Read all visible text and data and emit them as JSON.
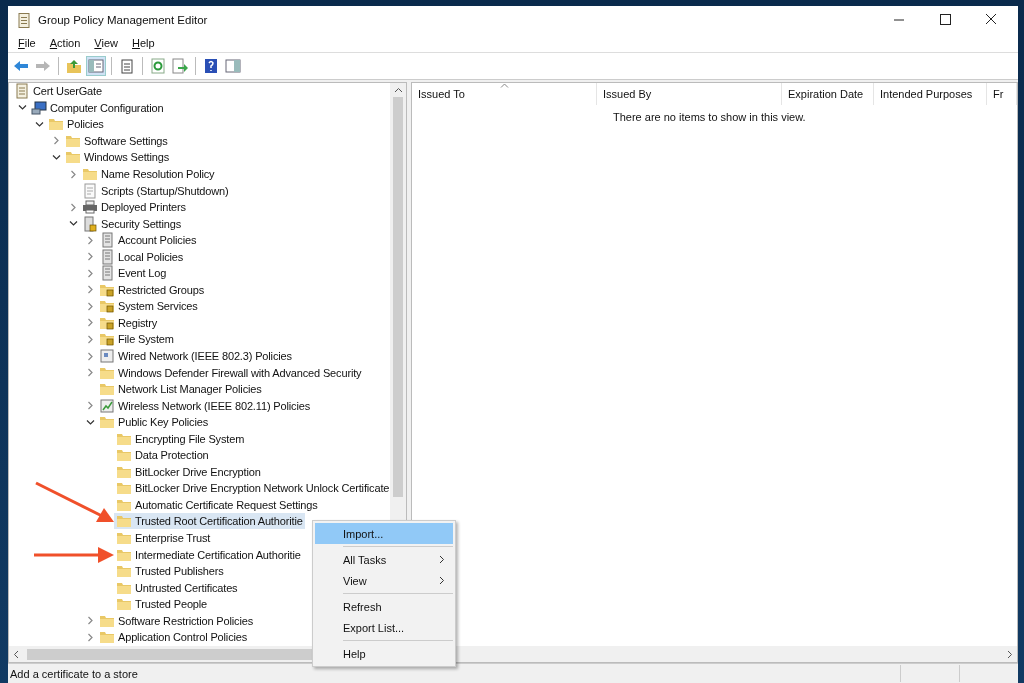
{
  "window": {
    "title": "Group Policy Management Editor"
  },
  "menu": [
    "File",
    "Action",
    "View",
    "Help"
  ],
  "toolbar": [
    [
      {
        "kind": "back",
        "disabled": false,
        "pressed": false
      },
      {
        "kind": "forward",
        "disabled": true,
        "pressed": false
      }
    ],
    [
      {
        "kind": "up",
        "disabled": false,
        "pressed": false
      },
      {
        "kind": "tree",
        "disabled": false,
        "pressed": true
      }
    ],
    [
      {
        "kind": "clipboard",
        "disabled": false,
        "pressed": false
      }
    ],
    [
      {
        "kind": "refresh",
        "disabled": false,
        "pressed": false
      },
      {
        "kind": "export",
        "disabled": false,
        "pressed": false
      }
    ],
    [
      {
        "kind": "help",
        "disabled": false,
        "pressed": false
      },
      {
        "kind": "pane",
        "disabled": false,
        "pressed": false
      }
    ]
  ],
  "tree": [
    {
      "label": "Cert UserGate",
      "kind": "doc",
      "selected": false,
      "children": [
        {
          "label": "Computer Configuration",
          "kind": "computer",
          "selected": false,
          "expanded": true,
          "children": [
            {
              "label": "Policies",
              "kind": "folder",
              "selected": false,
              "expanded": true,
              "children": [
                {
                  "label": "Software Settings",
                  "kind": "folder",
                  "selected": false,
                  "expanded": false
                },
                {
                  "label": "Windows Settings",
                  "kind": "folder",
                  "selected": false,
                  "expanded": true,
                  "children": [
                    {
                      "label": "Name Resolution Policy",
                      "kind": "folder",
                      "selected": false,
                      "expanded": false
                    },
                    {
                      "label": "Scripts (Startup/Shutdown)",
                      "kind": "script",
                      "selected": false
                    },
                    {
                      "label": "Deployed Printers",
                      "kind": "printer",
                      "selected": false,
                      "expanded": false
                    },
                    {
                      "label": "Security Settings",
                      "kind": "security",
                      "selected": false,
                      "expanded": true,
                      "children": [
                        {
                          "label": "Account Policies",
                          "kind": "server",
                          "selected": false,
                          "expanded": false
                        },
                        {
                          "label": "Local Policies",
                          "kind": "server",
                          "selected": false,
                          "expanded": false
                        },
                        {
                          "label": "Event Log",
                          "kind": "server",
                          "selected": false,
                          "expanded": false
                        },
                        {
                          "label": "Restricted Groups",
                          "kind": "lockfolder",
                          "selected": false,
                          "expanded": false
                        },
                        {
                          "label": "System Services",
                          "kind": "lockfolder",
                          "selected": false,
                          "expanded": false
                        },
                        {
                          "label": "Registry",
                          "kind": "lockfolder",
                          "selected": false,
                          "expanded": false
                        },
                        {
                          "label": "File System",
                          "kind": "lockfolder",
                          "selected": false,
                          "expanded": false
                        },
                        {
                          "label": "Wired Network (IEEE 802.3) Policies",
                          "kind": "network",
                          "selected": false,
                          "expanded": false
                        },
                        {
                          "label": "Windows Defender Firewall with Advanced Security",
                          "kind": "folder",
                          "selected": false,
                          "expanded": false
                        },
                        {
                          "label": "Network List Manager Policies",
                          "kind": "folder",
                          "selected": false
                        },
                        {
                          "label": "Wireless Network (IEEE 802.11) Policies",
                          "kind": "wireless",
                          "selected": false,
                          "expanded": false
                        },
                        {
                          "label": "Public Key Policies",
                          "kind": "folder",
                          "selected": false,
                          "expanded": true,
                          "children": [
                            {
                              "label": "Encrypting File System",
                              "kind": "folder",
                              "selected": false
                            },
                            {
                              "label": "Data Protection",
                              "kind": "folder",
                              "selected": false
                            },
                            {
                              "label": "BitLocker Drive Encryption",
                              "kind": "folder",
                              "selected": false
                            },
                            {
                              "label": "BitLocker Drive Encryption Network Unlock Certificate",
                              "kind": "folder",
                              "selected": false
                            },
                            {
                              "label": "Automatic Certificate Request Settings",
                              "kind": "folder",
                              "selected": false
                            },
                            {
                              "label": "Trusted Root Certification Authoritie",
                              "kind": "folder",
                              "selected": true
                            },
                            {
                              "label": "Enterprise Trust",
                              "kind": "folder",
                              "selected": false
                            },
                            {
                              "label": "Intermediate Certification Authoritie",
                              "kind": "folder",
                              "selected": false
                            },
                            {
                              "label": "Trusted Publishers",
                              "kind": "folder",
                              "selected": false
                            },
                            {
                              "label": "Untrusted Certificates",
                              "kind": "folder",
                              "selected": false
                            },
                            {
                              "label": "Trusted People",
                              "kind": "folder",
                              "selected": false
                            }
                          ]
                        },
                        {
                          "label": "Software Restriction Policies",
                          "kind": "folder",
                          "selected": false,
                          "expanded": false
                        },
                        {
                          "label": "Application Control Policies",
                          "kind": "folder",
                          "selected": false,
                          "expanded": false
                        }
                      ]
                    }
                  ]
                }
              ]
            }
          ]
        }
      ]
    }
  ],
  "list": {
    "columns": [
      {
        "label": "Issued To",
        "sorted": true
      },
      {
        "label": "Issued By",
        "sorted": false
      },
      {
        "label": "Expiration Date",
        "sorted": false
      },
      {
        "label": "Intended Purposes",
        "sorted": false
      },
      {
        "label": "Fr",
        "sorted": false
      }
    ],
    "empty_message": "There are no items to show in this view."
  },
  "context_menu": [
    {
      "label": "Import...",
      "selected": true,
      "submenu": false,
      "separator_after": true
    },
    {
      "label": "All Tasks",
      "selected": false,
      "submenu": true,
      "separator_after": false
    },
    {
      "label": "View",
      "selected": false,
      "submenu": true,
      "separator_after": true
    },
    {
      "label": "Refresh",
      "selected": false,
      "submenu": false,
      "separator_after": false
    },
    {
      "label": "Export List...",
      "selected": false,
      "submenu": false,
      "separator_after": true
    },
    {
      "label": "Help",
      "selected": false,
      "submenu": false,
      "separator_after": false
    }
  ],
  "annotation_arrows": [
    {
      "kind": "diagonal"
    },
    {
      "kind": "horizontal"
    }
  ],
  "status_bar": "Add a certificate to a store"
}
